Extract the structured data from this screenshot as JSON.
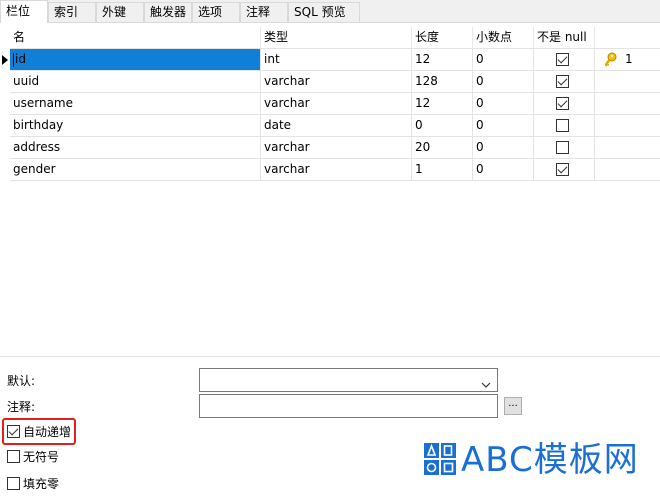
{
  "tabs": [
    "栏位",
    "索引",
    "外键",
    "触发器",
    "选项",
    "注释",
    "SQL 预览"
  ],
  "columns": [
    "名",
    "类型",
    "长度",
    "小数点",
    "不是 null"
  ],
  "rows": [
    {
      "name": "id",
      "type": "int",
      "length": "12",
      "decimals": "0",
      "not_null": true,
      "key": "1",
      "selected": true
    },
    {
      "name": "uuid",
      "type": "varchar",
      "length": "128",
      "decimals": "0",
      "not_null": true
    },
    {
      "name": "username",
      "type": "varchar",
      "length": "12",
      "decimals": "0",
      "not_null": true
    },
    {
      "name": "birthday",
      "type": "date",
      "length": "0",
      "decimals": "0",
      "not_null": false
    },
    {
      "name": "address",
      "type": "varchar",
      "length": "20",
      "decimals": "0",
      "not_null": false
    },
    {
      "name": "gender",
      "type": "varchar",
      "length": "1",
      "decimals": "0",
      "not_null": true
    }
  ],
  "properties": {
    "default_label": "默认:",
    "default_value": "",
    "comment_label": "注释:",
    "comment_value": "",
    "ellipsis_label": "..."
  },
  "options": [
    {
      "label": "自动递增",
      "checked": true
    },
    {
      "label": "无符号",
      "checked": false
    },
    {
      "label": "填充零",
      "checked": false
    }
  ],
  "logo": {
    "text": "ABC模板网",
    "color": "#1a6fd6"
  },
  "colors": {
    "selection": "#0f7fd8",
    "highlight": "#e02020"
  }
}
